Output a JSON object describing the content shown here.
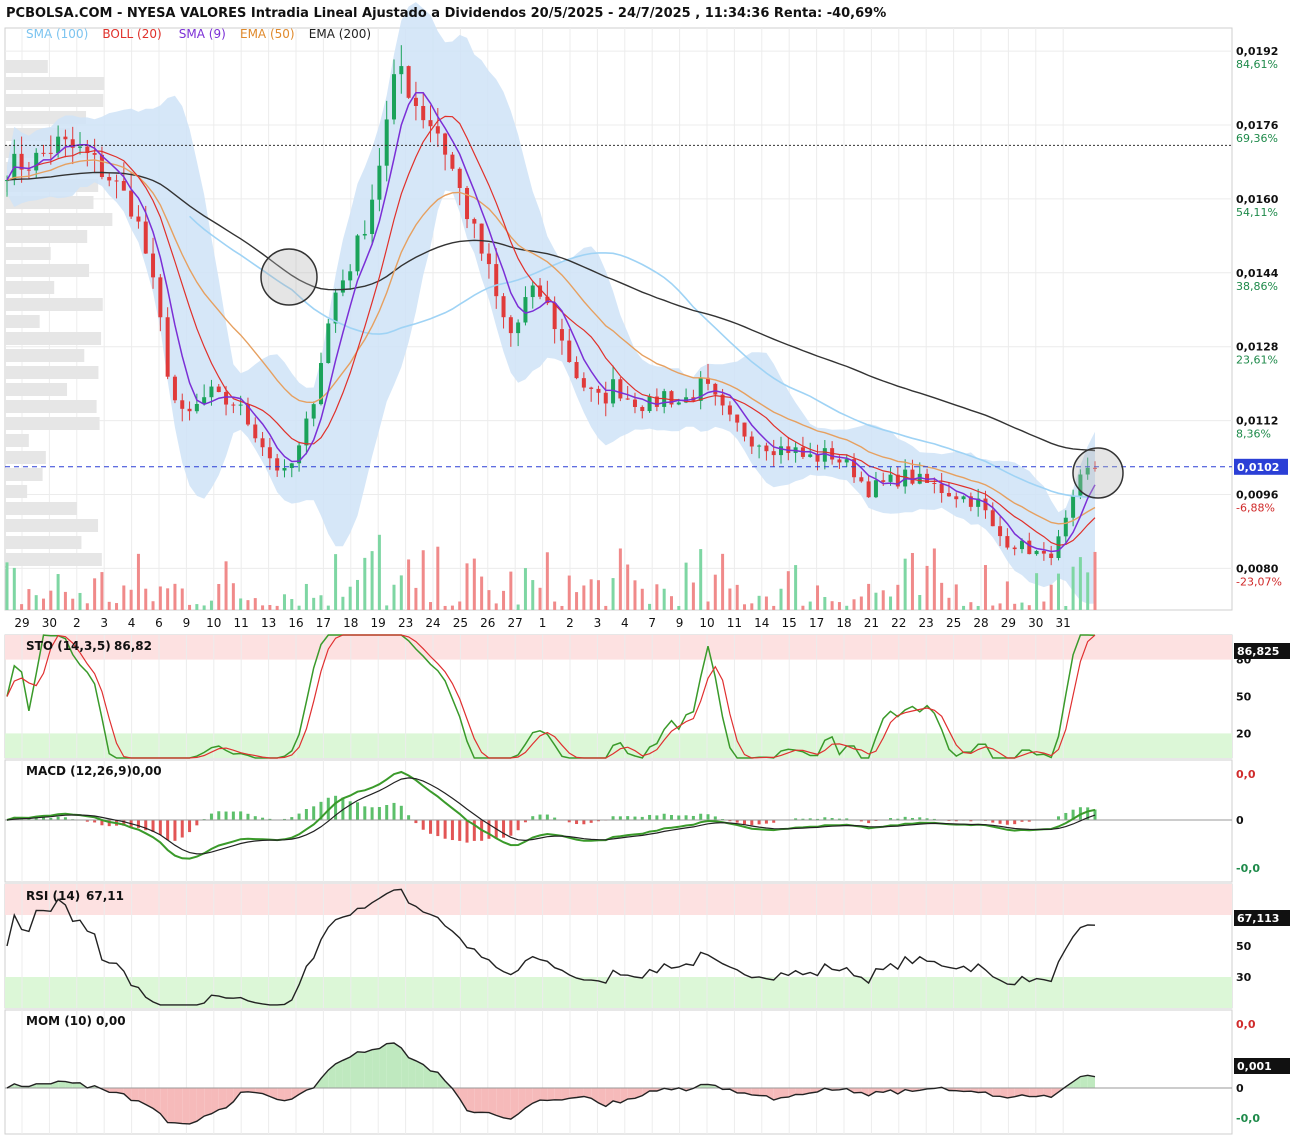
{
  "header": {
    "title": "PCBOLSA.COM - NYESA VALORES Intradia Lineal Ajustado a Dividendos 20/5/2025 - 24/7/2025 , 11:34:36 Renta: -40,69%"
  },
  "legend": [
    {
      "label": "SMA (100)",
      "color": "#7cc4f0"
    },
    {
      "label": "BOLL (20)",
      "color": "#e0302a"
    },
    {
      "label": "SMA (9)",
      "color": "#7b2fd6"
    },
    {
      "label": "EMA (50)",
      "color": "#e08a2c"
    },
    {
      "label": "EMA (200)",
      "color": "#222222"
    }
  ],
  "colors": {
    "up": "#1aa35a",
    "down": "#e03a3a",
    "band": "#cfe3f7",
    "sto_k": "#3a9a2a",
    "sto_d": "#e03030",
    "overbought": "#fde1e1",
    "oversold": "#dcf7d7"
  },
  "chart_data": {
    "type": "line",
    "main": {
      "y_ticks": [
        {
          "price": "0,0192",
          "pct": "84,61%",
          "v": 0.0192,
          "pos": true
        },
        {
          "price": "0,0176",
          "pct": "69,36%",
          "v": 0.0176,
          "pos": true
        },
        {
          "price": "0,0160",
          "pct": "54,11%",
          "v": 0.016,
          "pos": true
        },
        {
          "price": "0,0144",
          "pct": "38,86%",
          "v": 0.0144,
          "pos": true
        },
        {
          "price": "0,0128",
          "pct": "23,61%",
          "v": 0.0128,
          "pos": true
        },
        {
          "price": "0,0112",
          "pct": "8,36%",
          "v": 0.0112,
          "pos": true
        },
        {
          "price": "0,0096",
          "pct": "-6,88%",
          "v": 0.0096,
          "pos": false
        },
        {
          "price": "0,0080",
          "pct": "-23,07%",
          "v": 0.008,
          "pos": false
        }
      ],
      "ylim": [
        0.0071,
        0.0197
      ],
      "current_price": "0,0102",
      "current_value": 0.0102,
      "reference_line": 0.01716,
      "x_labels": [
        "29",
        "30",
        "2",
        "3",
        "4",
        "6",
        "9",
        "10",
        "11",
        "13",
        "16",
        "17",
        "18",
        "19",
        "23",
        "24",
        "25",
        "26",
        "27",
        "1",
        "2",
        "3",
        "4",
        "7",
        "9",
        "10",
        "11",
        "14",
        "15",
        "17",
        "18",
        "21",
        "22",
        "23",
        "25",
        "28",
        "29",
        "30",
        "31"
      ],
      "price_anchors": [
        [
          0,
          0.0167
        ],
        [
          2,
          0.0168
        ],
        [
          4,
          0.0172
        ],
        [
          6,
          0.017
        ],
        [
          8,
          0.0165
        ],
        [
          10,
          0.0158
        ],
        [
          11,
          0.0148
        ],
        [
          12,
          0.0135
        ],
        [
          13,
          0.0118
        ],
        [
          14,
          0.0112
        ],
        [
          15,
          0.0115
        ],
        [
          16,
          0.0118
        ],
        [
          17,
          0.0116
        ],
        [
          18,
          0.0116
        ],
        [
          19,
          0.0112
        ],
        [
          20,
          0.0108
        ],
        [
          21,
          0.0103
        ],
        [
          22,
          0.01
        ],
        [
          23,
          0.0105
        ],
        [
          24,
          0.0114
        ],
        [
          25,
          0.0128
        ],
        [
          26,
          0.014
        ],
        [
          27,
          0.0145
        ],
        [
          28,
          0.0152
        ],
        [
          29,
          0.0162
        ],
        [
          30,
          0.0176
        ],
        [
          31,
          0.019
        ],
        [
          32,
          0.0182
        ],
        [
          33,
          0.0178
        ],
        [
          34,
          0.0175
        ],
        [
          35,
          0.0168
        ],
        [
          36,
          0.016
        ],
        [
          37,
          0.0152
        ],
        [
          38,
          0.0145
        ],
        [
          39,
          0.0135
        ],
        [
          40,
          0.013
        ],
        [
          41,
          0.0138
        ],
        [
          42,
          0.014
        ],
        [
          43,
          0.0135
        ],
        [
          44,
          0.0128
        ],
        [
          45,
          0.0122
        ],
        [
          46,
          0.0118
        ],
        [
          47,
          0.0116
        ],
        [
          48,
          0.012
        ],
        [
          49,
          0.0117
        ],
        [
          50,
          0.0116
        ],
        [
          51,
          0.0115
        ],
        [
          52,
          0.0118
        ],
        [
          53,
          0.0116
        ],
        [
          54,
          0.0117
        ],
        [
          55,
          0.012
        ],
        [
          56,
          0.0116
        ],
        [
          57,
          0.0112
        ],
        [
          58,
          0.011
        ],
        [
          59,
          0.0108
        ],
        [
          60,
          0.0107
        ],
        [
          61,
          0.0106
        ],
        [
          62,
          0.0106
        ],
        [
          63,
          0.0104
        ],
        [
          64,
          0.0104
        ],
        [
          65,
          0.0105
        ],
        [
          66,
          0.0103
        ],
        [
          67,
          0.0101
        ],
        [
          68,
          0.0097
        ],
        [
          69,
          0.0098
        ],
        [
          70,
          0.0099
        ],
        [
          71,
          0.01
        ],
        [
          72,
          0.0099
        ],
        [
          73,
          0.0098
        ],
        [
          74,
          0.0097
        ],
        [
          75,
          0.0096
        ],
        [
          76,
          0.0095
        ],
        [
          77,
          0.0094
        ],
        [
          78,
          0.0088
        ],
        [
          79,
          0.0086
        ],
        [
          80,
          0.0085
        ],
        [
          81,
          0.0084
        ],
        [
          82,
          0.0082
        ],
        [
          83,
          0.0085
        ],
        [
          84,
          0.0092
        ],
        [
          85,
          0.01
        ],
        [
          86,
          0.0102
        ]
      ]
    },
    "sto": {
      "label": "STO (14,3,5)",
      "value": "86,82",
      "current": "86,825",
      "levels": [
        20,
        50,
        80
      ],
      "ylim": [
        0,
        100
      ]
    },
    "macd": {
      "label": "MACD (12,26,9)",
      "value": "0,00",
      "ticks": [
        "0,0",
        "0",
        "-0,0"
      ]
    },
    "rsi": {
      "label": "RSI (14)",
      "value": "67,11",
      "current": "67,113",
      "levels": [
        30,
        50,
        70
      ],
      "ylim": [
        10,
        90
      ]
    },
    "mom": {
      "label": "MOM (10)",
      "value": "0,00",
      "current": "0,001",
      "ticks": [
        "0,0",
        "0",
        "-0,0"
      ]
    }
  }
}
